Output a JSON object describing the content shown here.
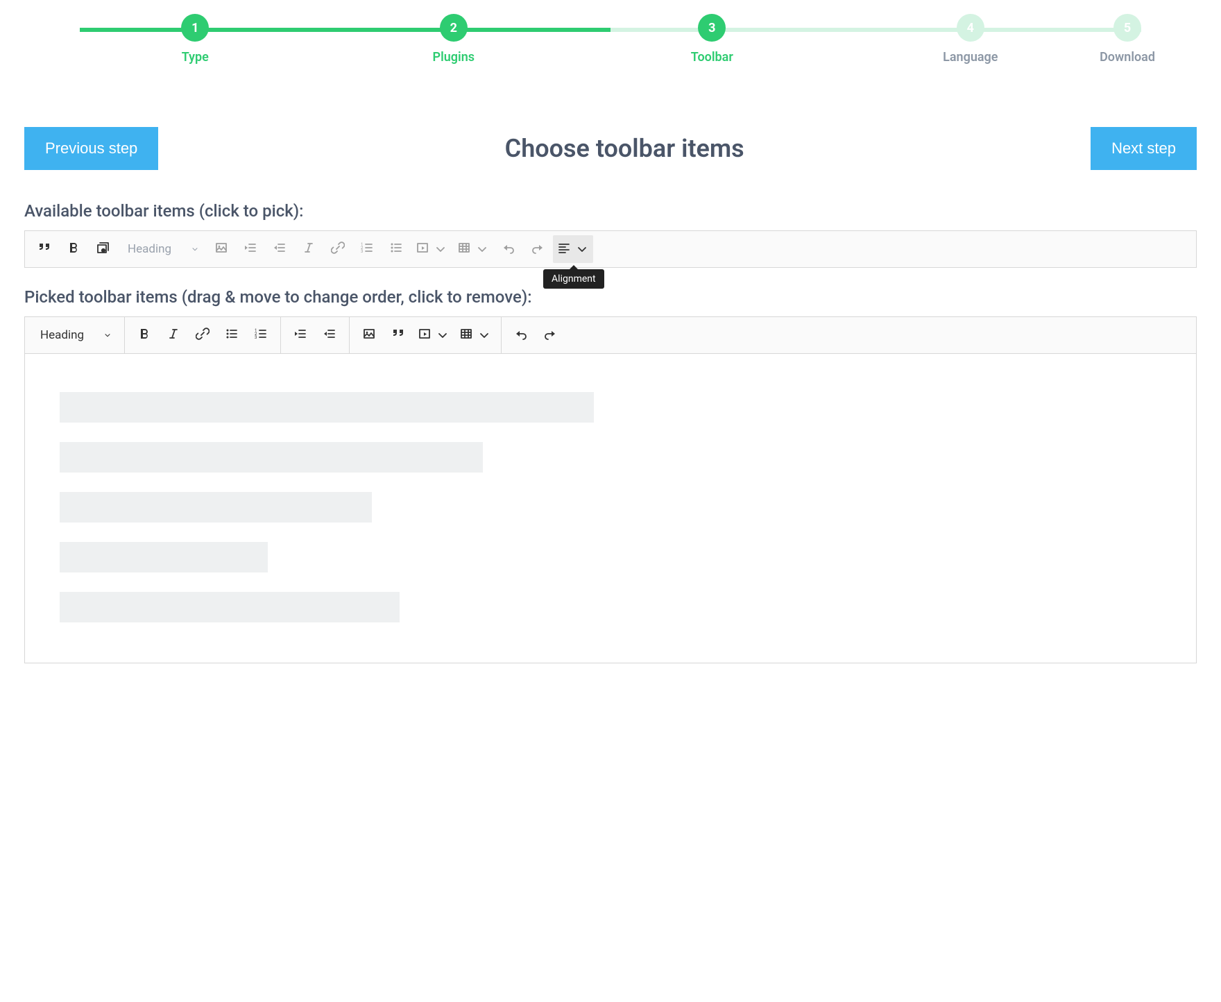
{
  "stepper": {
    "steps": [
      {
        "num": "1",
        "label": "Type",
        "state": "done"
      },
      {
        "num": "2",
        "label": "Plugins",
        "state": "done"
      },
      {
        "num": "3",
        "label": "Toolbar",
        "state": "done"
      },
      {
        "num": "4",
        "label": "Language",
        "state": "future"
      },
      {
        "num": "5",
        "label": "Download",
        "state": "future"
      }
    ]
  },
  "header": {
    "prev": "Previous step",
    "title": "Choose toolbar items",
    "next": "Next step"
  },
  "labels": {
    "available": "Available toolbar items (click to pick):",
    "picked": "Picked toolbar items (drag & move to change order, click to remove):"
  },
  "available_toolbar": {
    "heading_label": "Heading",
    "tooltip": "Alignment",
    "items": [
      {
        "icon": "blockquote",
        "name": "blockquote"
      },
      {
        "icon": "bold",
        "name": "bold"
      },
      {
        "icon": "media-browser",
        "name": "media-browser"
      },
      {
        "type": "heading"
      },
      {
        "icon": "image",
        "name": "image",
        "muted": true
      },
      {
        "icon": "indent",
        "name": "indent",
        "muted": true
      },
      {
        "icon": "outdent",
        "name": "outdent",
        "muted": true
      },
      {
        "icon": "italic",
        "name": "italic",
        "muted": true
      },
      {
        "icon": "link",
        "name": "link",
        "muted": true
      },
      {
        "icon": "numbered-list",
        "name": "numbered-list",
        "muted": true
      },
      {
        "icon": "bulleted-list",
        "name": "bulleted-list",
        "muted": true
      },
      {
        "icon": "media-embed",
        "name": "media-embed",
        "muted": true,
        "dropdown": true
      },
      {
        "icon": "table",
        "name": "table",
        "muted": true,
        "dropdown": true
      },
      {
        "icon": "undo",
        "name": "undo",
        "muted": true
      },
      {
        "icon": "redo",
        "name": "redo",
        "muted": true
      },
      {
        "icon": "alignment",
        "name": "alignment",
        "dropdown": true,
        "highlight": true
      }
    ]
  },
  "picked_toolbar": {
    "heading_label": "Heading",
    "groups": [
      [
        {
          "type": "heading"
        }
      ],
      [
        {
          "icon": "bold",
          "name": "bold"
        },
        {
          "icon": "italic",
          "name": "italic"
        },
        {
          "icon": "link",
          "name": "link"
        },
        {
          "icon": "bulleted-list",
          "name": "bulleted-list"
        },
        {
          "icon": "numbered-list",
          "name": "numbered-list"
        }
      ],
      [
        {
          "icon": "indent",
          "name": "indent"
        },
        {
          "icon": "outdent",
          "name": "outdent"
        }
      ],
      [
        {
          "icon": "image",
          "name": "image"
        },
        {
          "icon": "blockquote",
          "name": "blockquote"
        },
        {
          "icon": "media-embed",
          "name": "media-embed",
          "dropdown": true
        },
        {
          "icon": "table",
          "name": "table",
          "dropdown": true
        }
      ],
      [
        {
          "icon": "undo",
          "name": "undo"
        },
        {
          "icon": "redo",
          "name": "redo"
        }
      ]
    ]
  },
  "placeholders": [
    770,
    610,
    450,
    300,
    490
  ]
}
